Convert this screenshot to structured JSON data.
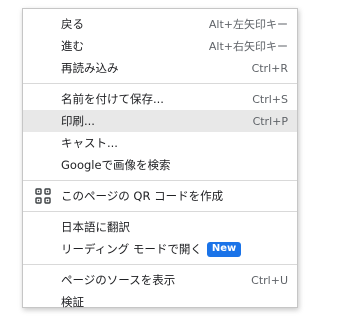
{
  "menu": {
    "groups": [
      [
        {
          "label": "戻る",
          "shortcut": "Alt+左矢印キー"
        },
        {
          "label": "進む",
          "shortcut": "Alt+右矢印キー"
        },
        {
          "label": "再読み込み",
          "shortcut": "Ctrl+R"
        }
      ],
      [
        {
          "label": "名前を付けて保存...",
          "shortcut": "Ctrl+S"
        },
        {
          "label": "印刷...",
          "shortcut": "Ctrl+P"
        },
        {
          "label": "キャスト...",
          "shortcut": ""
        },
        {
          "label": "Googleで画像を検索",
          "shortcut": ""
        }
      ],
      [
        {
          "label": "このページの QR コードを作成",
          "icon": "qr-code-icon"
        }
      ],
      [
        {
          "label": "日本語に翻訳"
        },
        {
          "label": "リーディング モードで開く",
          "badge": "New"
        }
      ],
      [
        {
          "label": "ページのソースを表示",
          "shortcut": "Ctrl+U"
        },
        {
          "label": "検証",
          "shortcut": ""
        }
      ]
    ],
    "highlighted_item": "印刷..."
  },
  "colors": {
    "badge_bg": "#1a73e8",
    "hover_bg": "#e8e8e8",
    "text": "#202124",
    "shortcut_text": "#5f6368"
  }
}
